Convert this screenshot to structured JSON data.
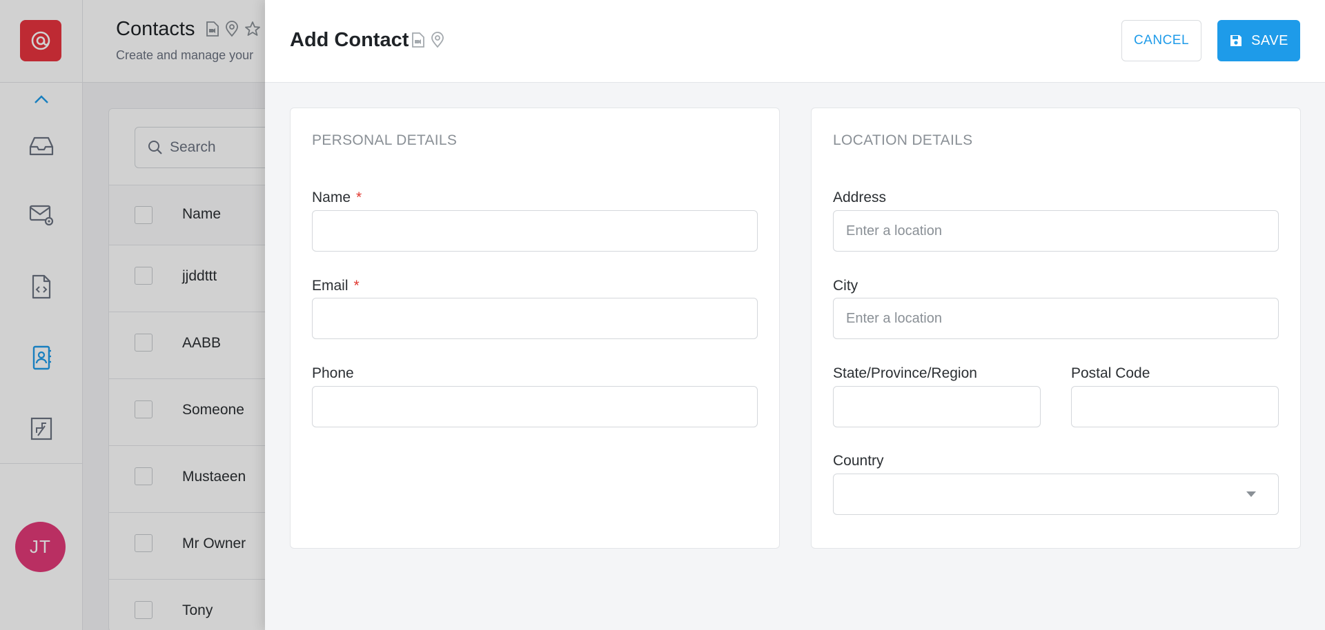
{
  "app": {
    "avatar_initials": "JT",
    "page_title": "Contacts",
    "page_subtitle": "Create and manage your",
    "search_placeholder": "Search",
    "list_header_name": "Name",
    "contacts": [
      "jjddttt",
      "AABB",
      "Someone",
      "Mustaeen",
      "Mr Owner",
      "Tony"
    ]
  },
  "drawer": {
    "title": "Add Contact",
    "cancel_label": "CANCEL",
    "save_label": "SAVE",
    "personal": {
      "title": "PERSONAL DETAILS",
      "name_label": "Name",
      "email_label": "Email",
      "phone_label": "Phone",
      "required_mark": "*"
    },
    "location": {
      "title": "LOCATION DETAILS",
      "address_label": "Address",
      "address_placeholder": "Enter a location",
      "city_label": "City",
      "city_placeholder": "Enter a location",
      "state_label": "State/Province/Region",
      "postal_label": "Postal Code",
      "country_label": "Country"
    }
  },
  "colors": {
    "accent": "#1e9be9",
    "logo": "#e8343f",
    "avatar": "#e23a78",
    "required": "#e0372f"
  }
}
